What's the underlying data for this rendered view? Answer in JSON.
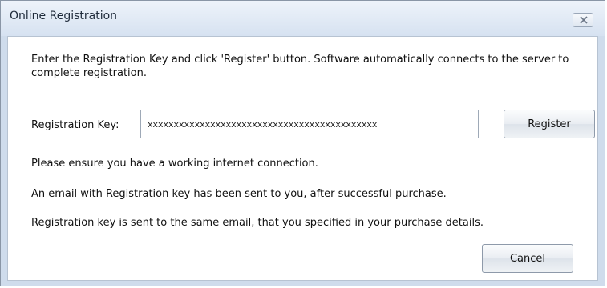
{
  "window": {
    "title": "Online Registration",
    "close_icon": "close-icon"
  },
  "content": {
    "intro": "Enter the Registration Key and click 'Register' button. Software automatically connects to the server to complete registration.",
    "key_label": "Registration Key:",
    "key_value": "xxxxxxxxxxxxxxxxxxxxxxxxxxxxxxxxxxxxxxxxxxxx",
    "register_label": "Register",
    "info_lines": [
      "Please ensure you have a working internet connection.",
      "An email with Registration key has been sent to you, after successful purchase.",
      "Registration key is sent to the same email, that you specified in your purchase details."
    ],
    "cancel_label": "Cancel"
  }
}
